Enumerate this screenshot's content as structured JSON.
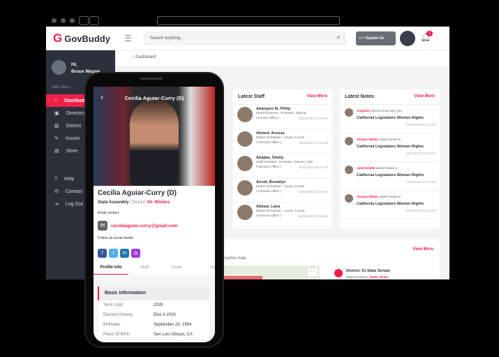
{
  "app": {
    "name": "GovBuddy",
    "logo_letter": "G",
    "brand_color": "#ee2049"
  },
  "header": {
    "search_placeholder": "Search anything...",
    "update_label": "Update Us",
    "notification_count": "1"
  },
  "breadcrumb": "Dashboard",
  "user": {
    "greeting": "Hi,",
    "name": "Bruce Wayne"
  },
  "sidebar": {
    "section": "Main Menu",
    "items": [
      {
        "label": "Dashboard",
        "icon": "home-icon"
      },
      {
        "label": "Directory",
        "icon": "directory-icon"
      },
      {
        "label": "District",
        "icon": "map-icon"
      },
      {
        "label": "Issues",
        "icon": "edit-icon"
      },
      {
        "label": "Store",
        "icon": "store-icon"
      }
    ],
    "bottom": [
      {
        "label": "Help",
        "icon": "help-icon"
      },
      {
        "label": "Contact",
        "icon": "phone-icon"
      },
      {
        "label": "Log Out",
        "icon": "logout-icon"
      }
    ]
  },
  "staff": {
    "title": "Latest Staff",
    "view_more": "View More",
    "items": [
      {
        "name": "Abarquez III, Philip",
        "role": "District Director - Feinstein, Dianne",
        "office": "( Fresno Office )",
        "time": "19/03/2020  03:24 AM"
      },
      {
        "name": "Ahmed, Aroosa",
        "role": "District Scheduler - Leyva, Connie",
        "office": "( Pomona Office )",
        "time": "19/03/2020  03:24 AM"
      },
      {
        "name": "Abajian, Shelly",
        "role": "Staff Assistant - Feinstein, Dianne ( San",
        "office": "Francisco Office )",
        "time": "19/03/2020  03:24 AM"
      },
      {
        "name": "Alcott, Brooklyn",
        "role": "District Scheduler - Leyva, Connie",
        "office": "( Pomona Office )",
        "time": "19/03/2020  03:24 AM"
      },
      {
        "name": "Abbasi, Lana",
        "role": "District Scheduler - Leyva, Connie",
        "office": "( Pomona Office )",
        "time": "19/03/2020  03:24 AM"
      }
    ]
  },
  "notes": {
    "title": "Latest Notes",
    "view_more": "View More",
    "items": [
      {
        "user": "Angelica",
        "action": "shared Issue with you",
        "subject": "California Legislators Women Rights",
        "time": "19/03/2020  03:24 AM"
      },
      {
        "user": "Tommy Weber",
        "action": "added Notes in",
        "subject": "California Legislators Women Rights",
        "time": "19/03/2020  03:24 AM"
      },
      {
        "user": "Julie Estelle",
        "action": "added Notes in",
        "subject": "California Legislators Women Rights",
        "time": "19/03/2020  03:24 AM"
      },
      {
        "user": "Tommy Weber",
        "action": "added Notes in",
        "subject": "California Legislators Women Rights",
        "time": "19/03/2020  03:24 AM"
      }
    ]
  },
  "map": {
    "view_more": "View More",
    "desc": "eractive map.",
    "district": "District: 01 State Senate",
    "rep_label": "Representative:",
    "rep_name": "Dahle, Brian"
  },
  "phone": {
    "title": "Cecilia Aguiar-Curry (D)",
    "name": "Cecilia Aguiar-Curry (D)",
    "chamber": "State Assembly",
    "district_label": "District:",
    "district": "04- Winters",
    "email_label": "Email contact",
    "email": "ceciliaaguiar.curry@gmail.com",
    "social_label": "Follow on social media",
    "tabs": [
      "Profile Info",
      "Staff",
      "Issue",
      "Ac"
    ],
    "section": "Basic Information",
    "info": [
      {
        "k": "Term Limit:",
        "v": "2028"
      },
      {
        "k": "Election History:",
        "v": "Elec A 2016"
      },
      {
        "k": "Birthdate:",
        "v": "September 29, 1954"
      },
      {
        "k": "Place Of Birth:",
        "v": "San Luis Obispo, CA"
      }
    ]
  }
}
